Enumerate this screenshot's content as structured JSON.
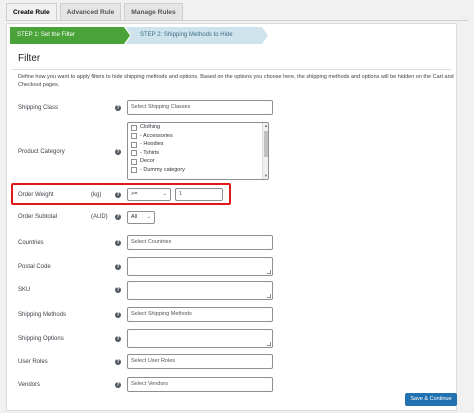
{
  "tabs": [
    "Create Rule",
    "Advanced Rule",
    "Manage Rules"
  ],
  "steps": {
    "step1": "STEP 1: Set the Filter",
    "step2": "STEP 2: Shipping Methods to Hide"
  },
  "filter": {
    "title": "Filter",
    "description": "Define how you want to apply filters to hide shipping methods and options. Based on the options you choose here, the shipping methods and options will be hidden on the Cart and Checkout pages."
  },
  "fields": {
    "shipping_class": {
      "label": "Shipping Class",
      "placeholder": "Select Shipping Classes"
    },
    "product_category": {
      "label": "Product Category",
      "options": [
        "Clothing",
        "- Accessories",
        "- Hoodies",
        "- Tshirts",
        "Decor",
        "- Dummy category"
      ]
    },
    "order_weight": {
      "label": "Order Weight",
      "unit": "(kg)",
      "operator": ">=",
      "value": "1"
    },
    "order_subtotal": {
      "label": "Order Subtotal",
      "unit": "(AUD)",
      "value": "All"
    },
    "countries": {
      "label": "Countries",
      "placeholder": "Select Countries"
    },
    "postal_code": {
      "label": "Postal Code"
    },
    "sku": {
      "label": "SKU"
    },
    "shipping_methods": {
      "label": "Shipping Methods",
      "placeholder": "Select Shipping Methods"
    },
    "shipping_options": {
      "label": "Shipping Options"
    },
    "user_roles": {
      "label": "User Roles",
      "placeholder": "Select User Roles"
    },
    "vendors": {
      "label": "Vendors",
      "placeholder": "Select Vendors"
    }
  },
  "help_glyph": "?",
  "save_label": "Save & Continue"
}
